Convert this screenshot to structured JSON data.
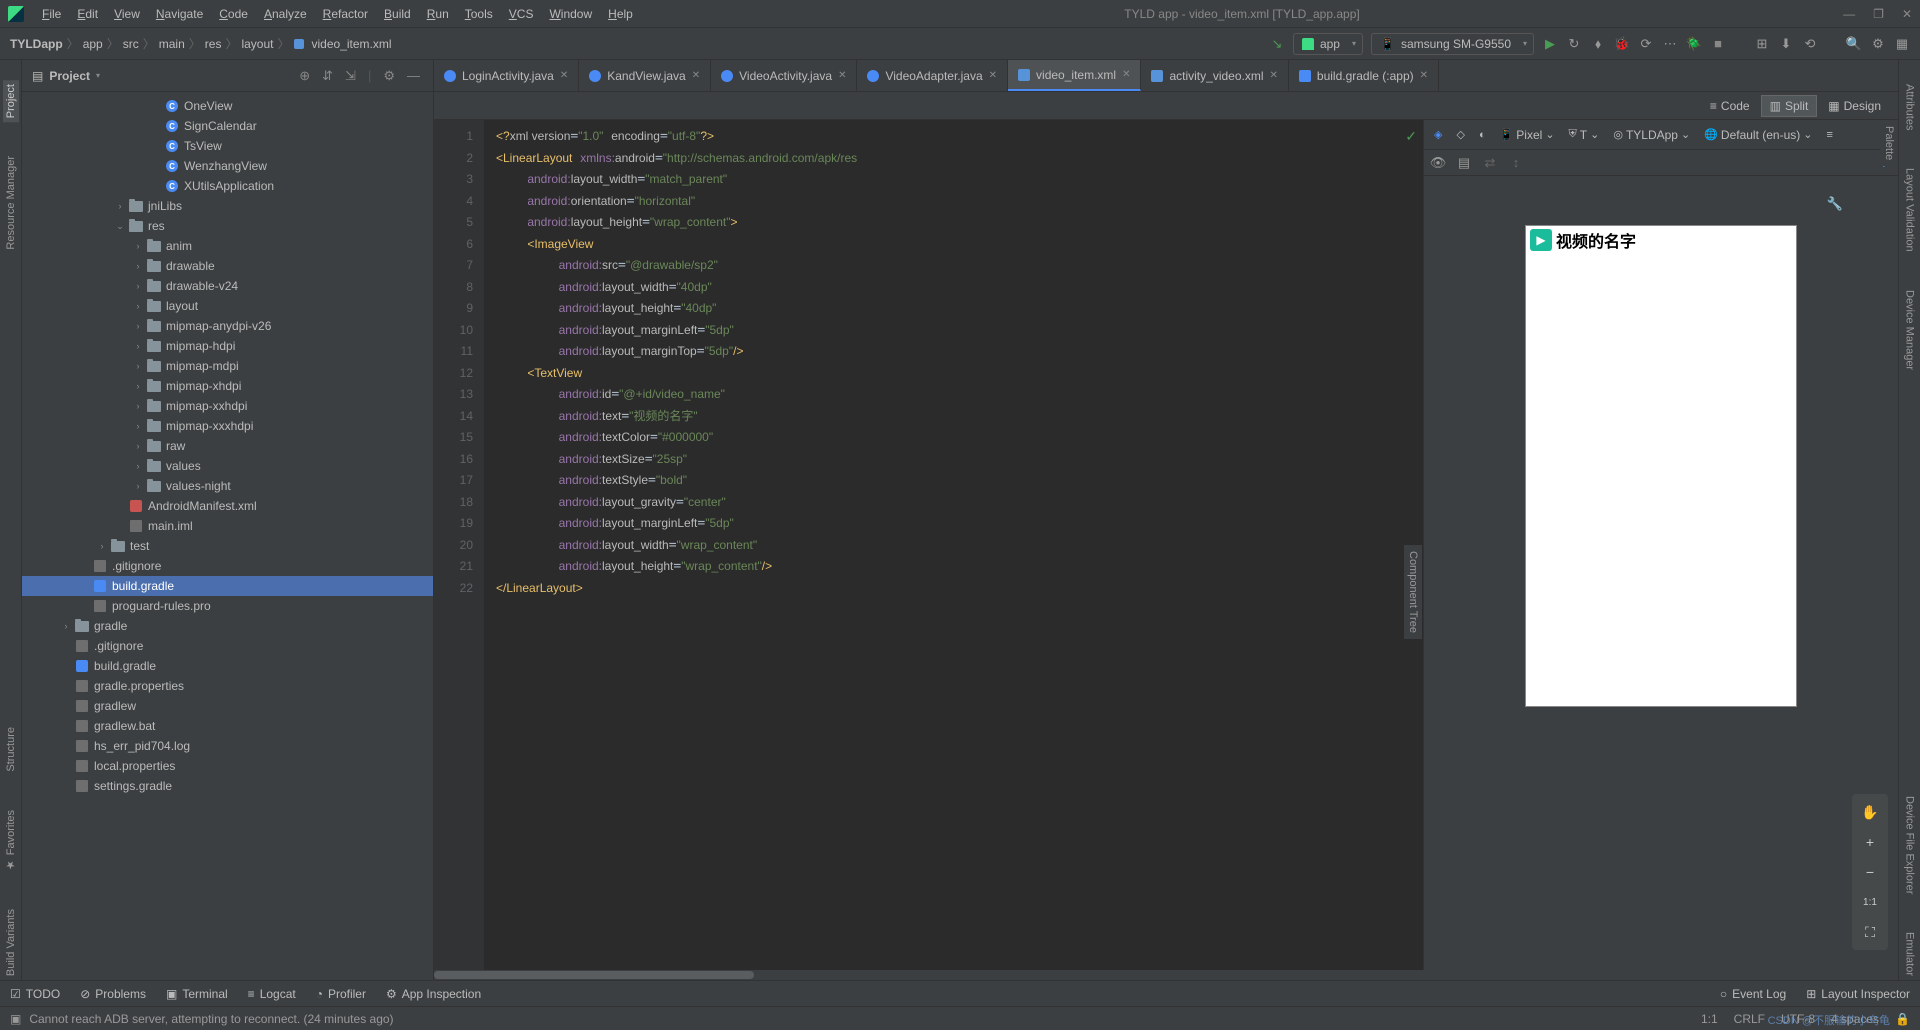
{
  "menu": [
    "File",
    "Edit",
    "View",
    "Navigate",
    "Code",
    "Analyze",
    "Refactor",
    "Build",
    "Run",
    "Tools",
    "VCS",
    "Window",
    "Help"
  ],
  "window_title": "TYLD app - video_item.xml [TYLD_app.app]",
  "breadcrumb": [
    "TYLDapp",
    "app",
    "src",
    "main",
    "res",
    "layout",
    "video_item.xml"
  ],
  "run_config": "app",
  "device": "samsung SM-G9550",
  "panel": {
    "title": "Project"
  },
  "tree": [
    {
      "indent": 7,
      "arrow": "",
      "icon": "cls",
      "label": "OneView"
    },
    {
      "indent": 7,
      "arrow": "",
      "icon": "cls",
      "label": "SignCalendar"
    },
    {
      "indent": 7,
      "arrow": "",
      "icon": "cls",
      "label": "TsView"
    },
    {
      "indent": 7,
      "arrow": "",
      "icon": "cls",
      "label": "WenzhangView"
    },
    {
      "indent": 7,
      "arrow": "",
      "icon": "cls",
      "label": "XUtilsApplication"
    },
    {
      "indent": 5,
      "arrow": "›",
      "icon": "fold",
      "label": "jniLibs"
    },
    {
      "indent": 5,
      "arrow": "⌄",
      "icon": "fold",
      "label": "res"
    },
    {
      "indent": 6,
      "arrow": "›",
      "icon": "fold",
      "label": "anim"
    },
    {
      "indent": 6,
      "arrow": "›",
      "icon": "fold",
      "label": "drawable"
    },
    {
      "indent": 6,
      "arrow": "›",
      "icon": "fold",
      "label": "drawable-v24"
    },
    {
      "indent": 6,
      "arrow": "›",
      "icon": "fold",
      "label": "layout"
    },
    {
      "indent": 6,
      "arrow": "›",
      "icon": "fold",
      "label": "mipmap-anydpi-v26"
    },
    {
      "indent": 6,
      "arrow": "›",
      "icon": "fold",
      "label": "mipmap-hdpi"
    },
    {
      "indent": 6,
      "arrow": "›",
      "icon": "fold",
      "label": "mipmap-mdpi"
    },
    {
      "indent": 6,
      "arrow": "›",
      "icon": "fold",
      "label": "mipmap-xhdpi"
    },
    {
      "indent": 6,
      "arrow": "›",
      "icon": "fold",
      "label": "mipmap-xxhdpi"
    },
    {
      "indent": 6,
      "arrow": "›",
      "icon": "fold",
      "label": "mipmap-xxxhdpi"
    },
    {
      "indent": 6,
      "arrow": "›",
      "icon": "fold",
      "label": "raw"
    },
    {
      "indent": 6,
      "arrow": "›",
      "icon": "fold",
      "label": "values"
    },
    {
      "indent": 6,
      "arrow": "›",
      "icon": "fold",
      "label": "values-night"
    },
    {
      "indent": 5,
      "arrow": "",
      "icon": "xml",
      "label": "AndroidManifest.xml"
    },
    {
      "indent": 5,
      "arrow": "",
      "icon": "file",
      "label": "main.iml"
    },
    {
      "indent": 4,
      "arrow": "›",
      "icon": "fold",
      "label": "test"
    },
    {
      "indent": 3,
      "arrow": "",
      "icon": "file",
      "label": ".gitignore"
    },
    {
      "indent": 3,
      "arrow": "",
      "icon": "gradle",
      "label": "build.gradle",
      "selected": true
    },
    {
      "indent": 3,
      "arrow": "",
      "icon": "file",
      "label": "proguard-rules.pro"
    },
    {
      "indent": 2,
      "arrow": "›",
      "icon": "fold",
      "label": "gradle"
    },
    {
      "indent": 2,
      "arrow": "",
      "icon": "file",
      "label": ".gitignore"
    },
    {
      "indent": 2,
      "arrow": "",
      "icon": "gradle",
      "label": "build.gradle"
    },
    {
      "indent": 2,
      "arrow": "",
      "icon": "file",
      "label": "gradle.properties"
    },
    {
      "indent": 2,
      "arrow": "",
      "icon": "file",
      "label": "gradlew"
    },
    {
      "indent": 2,
      "arrow": "",
      "icon": "file",
      "label": "gradlew.bat"
    },
    {
      "indent": 2,
      "arrow": "",
      "icon": "file",
      "label": "hs_err_pid704.log"
    },
    {
      "indent": 2,
      "arrow": "",
      "icon": "file",
      "label": "local.properties"
    },
    {
      "indent": 2,
      "arrow": "",
      "icon": "file",
      "label": "settings.gradle"
    }
  ],
  "tabs": [
    {
      "label": "LoginActivity.java",
      "icon": "java"
    },
    {
      "label": "KandView.java",
      "icon": "java"
    },
    {
      "label": "VideoActivity.java",
      "icon": "java"
    },
    {
      "label": "VideoAdapter.java",
      "icon": "java"
    },
    {
      "label": "video_item.xml",
      "icon": "xml",
      "active": true
    },
    {
      "label": "activity_video.xml",
      "icon": "xml"
    },
    {
      "label": "build.gradle (:app)",
      "icon": "gradle"
    }
  ],
  "view_modes": [
    {
      "label": "Code",
      "icon": "≡"
    },
    {
      "label": "Split",
      "icon": "▥",
      "active": true
    },
    {
      "label": "Design",
      "icon": "▦"
    }
  ],
  "design_controls": {
    "pixel": "Pixel",
    "theme": "T",
    "app": "TYLDApp",
    "locale": "Default (en-us)"
  },
  "code_lines": 22,
  "preview_text": "视频的名字",
  "left_tabs": [
    "Project",
    "Resource Manager",
    "Structure",
    "Favorites",
    "Build Variants"
  ],
  "right_tabs": [
    "Attributes",
    "Layout Validation",
    "Device Manager",
    "Device File Explorer",
    "Emulator"
  ],
  "bottom_tabs": [
    {
      "icon": "☑",
      "label": "TODO"
    },
    {
      "icon": "⊘",
      "label": "Problems"
    },
    {
      "icon": "▣",
      "label": "Terminal"
    },
    {
      "icon": "≡",
      "label": "Logcat"
    },
    {
      "icon": "◔",
      "label": "Profiler"
    },
    {
      "icon": "⚙",
      "label": "App Inspection"
    }
  ],
  "bottom_right": [
    {
      "icon": "○",
      "label": "Event Log"
    },
    {
      "icon": "⊞",
      "label": "Layout Inspector"
    }
  ],
  "status": {
    "msg": "Cannot reach ADB server, attempting to reconnect. (24 minutes ago)",
    "pos": "1:1",
    "sep": "CRLF",
    "enc": "UTF-8",
    "spaces": "4 spaces"
  },
  "watermark": "CSDN @不服输的小乌龟"
}
